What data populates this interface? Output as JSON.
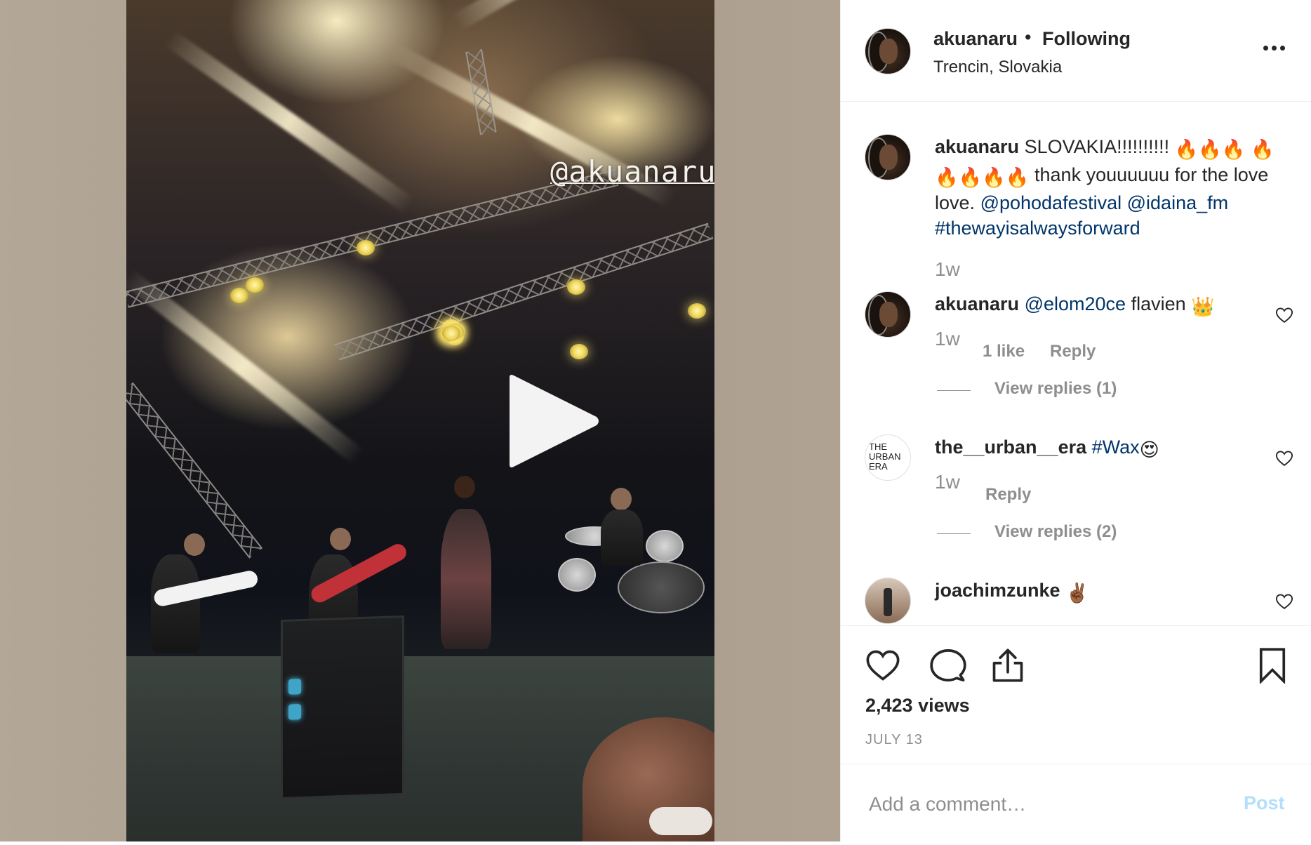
{
  "post": {
    "username": "akuanaru",
    "follow_status": "Following",
    "bullet": "•",
    "location": "Trencin, Slovakia"
  },
  "video": {
    "story_tag": "@akuanaru"
  },
  "caption": {
    "username": "akuanaru",
    "text_1": "SLOVAKIA!!!!!!!!!!",
    "text_2": "thank youuuuuu for the love love.",
    "mention_1": "@pohodafestival",
    "mention_2": "@idaina_fm",
    "hashtag": "#thewayisalwaysforward",
    "time": "1w"
  },
  "comments": [
    {
      "username": "akuanaru",
      "mention": "@elom20ce",
      "text": "flavien",
      "time": "1w",
      "likes": "1 like",
      "reply_label": "Reply",
      "view_replies": "View replies (1)"
    },
    {
      "username": "the__urban__era",
      "hashtag": "#Wax",
      "time": "1w",
      "reply_label": "Reply",
      "view_replies": "View replies (2)",
      "avatar_text": "THE URBAN ERA"
    },
    {
      "username": "joachimzunke"
    }
  ],
  "stats": {
    "views": "2,423 views",
    "date": "JULY 13"
  },
  "add_comment": {
    "placeholder": "Add a comment…",
    "post_label": "Post"
  },
  "colors": {
    "link": "#003569",
    "muted": "#8e8e8e",
    "post_disabled": "#b2dffc"
  }
}
